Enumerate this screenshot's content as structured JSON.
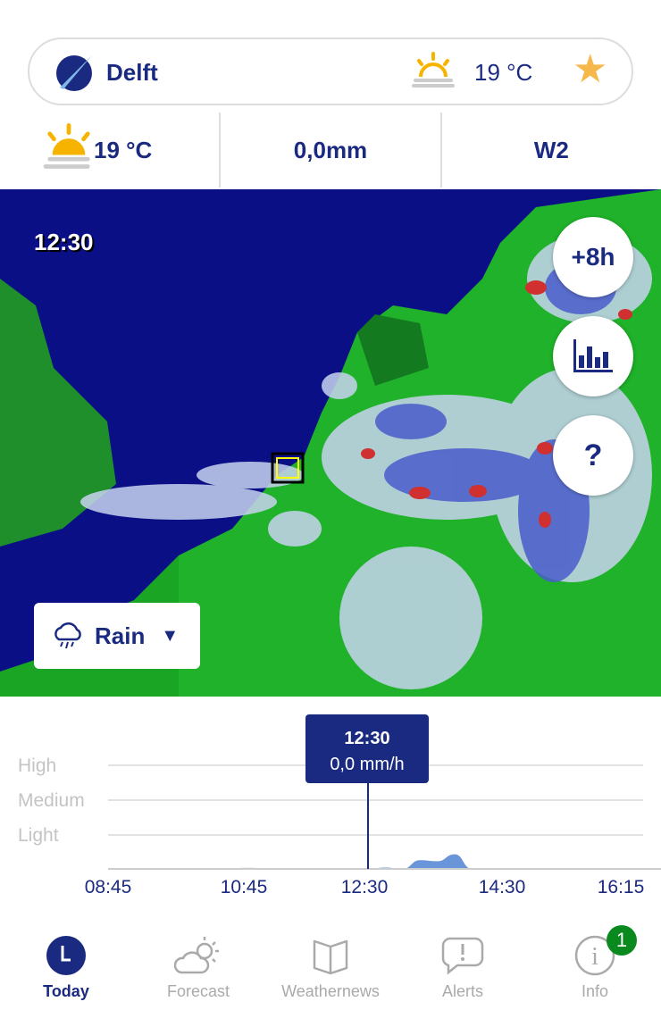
{
  "header": {
    "city": "Delft",
    "temperature": "19 °C",
    "weather_icon": "sun-rising-icon",
    "favorite_icon": "star-icon",
    "star_color": "#f6b84a"
  },
  "stats": {
    "temperature": "19 °C",
    "precipitation": "0,0mm",
    "wind": "W2"
  },
  "map": {
    "time": "12:30",
    "buttons": {
      "forecast": "+8h",
      "chart_icon": "bar-chart-icon",
      "help": "?"
    },
    "layer": {
      "label": "Rain",
      "icon": "rain-cloud-icon",
      "dropdown": "▼"
    }
  },
  "chart_data": {
    "type": "area",
    "y_levels": [
      "High",
      "Medium",
      "Light"
    ],
    "x_ticks": [
      "08:45",
      "10:45",
      "12:30",
      "14:30",
      "16:15"
    ],
    "tooltip": {
      "time": "12:30",
      "value": "0,0 mm/h"
    },
    "x": [
      "08:45",
      "09:15",
      "09:45",
      "10:15",
      "10:45",
      "11:15",
      "11:45",
      "12:15",
      "12:30",
      "12:45",
      "13:00",
      "13:15",
      "13:30",
      "13:45",
      "14:00",
      "14:15",
      "14:30",
      "15:00",
      "15:30",
      "16:15"
    ],
    "values": [
      0,
      0,
      0,
      0,
      0.03,
      0,
      0,
      0,
      0,
      0.04,
      0,
      0.25,
      0.22,
      0.42,
      0,
      0,
      0,
      0,
      0,
      0
    ],
    "color": "#6a95d8"
  },
  "nav": [
    {
      "label": "Today",
      "icon": "clock-icon"
    },
    {
      "label": "Forecast",
      "icon": "cloud-sun-icon"
    },
    {
      "label": "Weathernews",
      "icon": "book-icon"
    },
    {
      "label": "Alerts",
      "icon": "alert-bubble-icon"
    },
    {
      "label": "Info",
      "icon": "info-icon",
      "badge": "1"
    }
  ]
}
